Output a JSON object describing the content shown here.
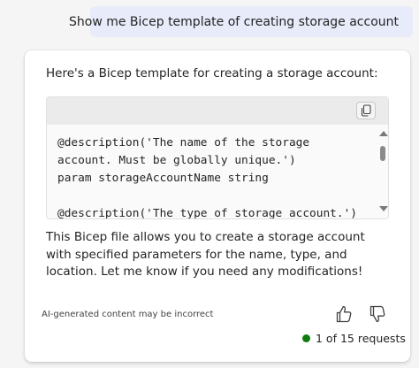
{
  "user_message": "Show me Bicep template of creating storage account",
  "response": {
    "intro": "Here's a Bicep template for creating a storage account:",
    "code_lines": [
      "@description('The name of the storage",
      "account. Must be globally unique.')",
      "param storageAccountName string",
      "",
      "@description('The type of storage account.')"
    ],
    "explanation": "This Bicep file allows you to create a storage account with specified parameters for the name, type, and location. Let me know if you need any modifications!",
    "disclaimer": "AI-generated content may be incorrect",
    "request_counter": "1 of 15 requests"
  },
  "icons": {
    "copy": "copy-icon",
    "thumbs_up": "thumbs-up-icon",
    "thumbs_down": "thumbs-down-icon",
    "status": "status-dot"
  },
  "colors": {
    "user_bubble": "#e8ebfa",
    "status_dot": "#107c10",
    "code_header": "#ebebeb"
  }
}
